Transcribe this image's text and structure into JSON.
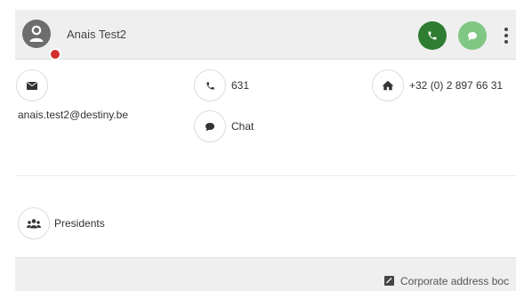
{
  "header": {
    "contact_name": "Anais Test2",
    "presence_status_color": "#d32f2f",
    "call_button_color": "#2e7d32",
    "chat_button_color": "#81c784",
    "icons": [
      "person-icon",
      "phone-icon",
      "chat-bubble-icon",
      "more-vertical-icon"
    ]
  },
  "details": {
    "email": "anais.test2@destiny.be",
    "extension": "631",
    "chat_label": "Chat",
    "home_phone": "+32 (0) 2 897 66 31"
  },
  "groups": {
    "label": "Presidents"
  },
  "footer": {
    "source_label": "Corporate address boc"
  }
}
